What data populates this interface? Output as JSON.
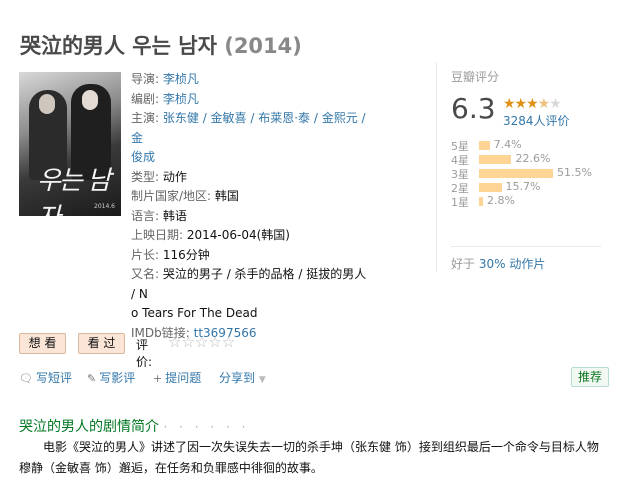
{
  "title": {
    "name": "哭泣的男人 우는 남자",
    "year": "(2014)"
  },
  "poster": {
    "glyphs": "우는 남자",
    "caption": "2014.6"
  },
  "info": {
    "director_label": "导演:",
    "director": "李桢凡",
    "writer_label": "编剧:",
    "writer": "李桢凡",
    "cast_label": "主演:",
    "cast": [
      "张东健",
      "金敏喜",
      "布莱恩·泰",
      "金熙元",
      "金俊成"
    ],
    "cast_sep": " / ",
    "cast_line1": "张东健 / 金敏喜 / 布莱恩·泰 / 金熙元 / 金",
    "cast_line2": "俊成",
    "genre_label": "类型:",
    "genre": "动作",
    "country_label": "制片国家/地区:",
    "country": "韩国",
    "language_label": "语言:",
    "language": "韩语",
    "release_label": "上映日期:",
    "release": "2014-06-04(韩国)",
    "runtime_label": "片长:",
    "runtime": "116分钟",
    "aka_label": "又名:",
    "aka_line1": "哭泣的男子 / 杀手的品格 / 挺拔的男人 / N",
    "aka_line2": "o Tears For The Dead",
    "imdb_label": "IMDb链接:",
    "imdb": "tt3697566"
  },
  "rating": {
    "label": "豆瓣评分",
    "score": "6.3",
    "votes": "3284人评价",
    "stars_on": "★★★",
    "stars_half": "★",
    "stars_off": "★",
    "distribution": [
      {
        "label": "5星",
        "pct": "7.4%",
        "value": 7.4
      },
      {
        "label": "4星",
        "pct": "22.6%",
        "value": 22.6
      },
      {
        "label": "3星",
        "pct": "51.5%",
        "value": 51.5
      },
      {
        "label": "2星",
        "pct": "15.7%",
        "value": 15.7
      },
      {
        "label": "1星",
        "pct": "2.8%",
        "value": 2.8
      }
    ],
    "better_prefix": "好于 ",
    "better_link": "30% 动作片"
  },
  "actions": {
    "want": "想 看",
    "watched": "看 过",
    "rate_label": "评价:",
    "rate_stars": "☆☆☆☆☆"
  },
  "toolbar": {
    "short_review": "写短评",
    "review": "写影评",
    "question": "提问题",
    "share": "分享到",
    "share_arrow": "▼",
    "recommend": "推荐"
  },
  "synopsis": {
    "title": "哭泣的男人的剧情简介",
    "dots": "· · · · · ·",
    "text": "电影《哭泣的男人》讲述了因一次失误失去一切的杀手坤（张东健 饰）接到组织最后一个命令与目标人物穆静（金敏喜 饰）邂逅，在任务和负罪感中徘徊的故事。"
  }
}
